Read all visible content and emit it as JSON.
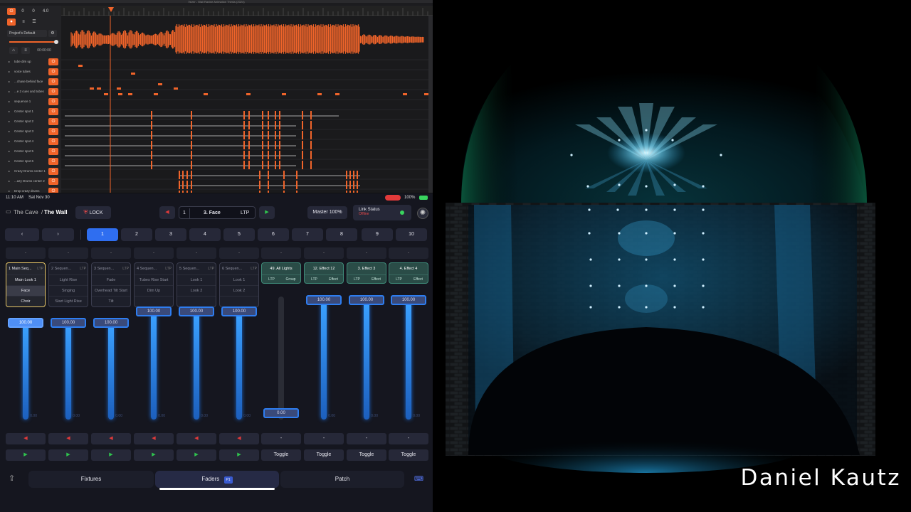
{
  "daw": {
    "title": "Vezer - Wall Ravine Animation Thesis (2024)",
    "time_display": "00:00:00",
    "project_select": "Project's Default",
    "transport_values": [
      "0",
      "0",
      "4.0"
    ],
    "tracks": [
      {
        "name": "tube dim up"
      },
      {
        "name": "voice tubes"
      },
      {
        "name": "...chase behind face"
      },
      {
        "name": "...e 2 cues and tubes"
      },
      {
        "name": "sequence 1"
      },
      {
        "name": "Center spot 1"
      },
      {
        "name": "Center spot 2"
      },
      {
        "name": "Center spot 3"
      },
      {
        "name": "Center spot 4"
      },
      {
        "name": "Center spot 5"
      },
      {
        "name": "Center spot 6"
      },
      {
        "name": "Crazy Drums center 1"
      },
      {
        "name": "...azy Drums center 2"
      },
      {
        "name": "Drop crazy drums"
      }
    ],
    "accent": "#f0642a"
  },
  "status_bar": {
    "time": "11:10 AM",
    "date": "Sat Nov 30",
    "battery": "100%"
  },
  "header": {
    "breadcrumb_parent": "The Cave",
    "breadcrumb_sep": "/",
    "breadcrumb_current": "The Wall",
    "lock_label": "LOCK",
    "cue_number": "1",
    "cue_name": "3. Face",
    "cue_mode": "LTP",
    "master_label": "Master 100%",
    "link_status_label": "Link Status",
    "link_status_value": "Offline"
  },
  "pages": {
    "prev": "‹",
    "next": "›",
    "numbers": [
      "1",
      "2",
      "3",
      "4",
      "5",
      "6",
      "7",
      "8",
      "9",
      "10"
    ],
    "active_index": 0
  },
  "dash_label": "-",
  "playbacks": [
    {
      "num": "1",
      "title": "Main Seq...",
      "mode": "LTP",
      "cues": [
        "Main Look 1",
        "Face",
        "Choir"
      ],
      "style": "selected",
      "level_text": "100.00",
      "level": 1.0
    },
    {
      "num": "2",
      "title": "Sequen...",
      "mode": "LTP",
      "cues": [
        "Light Rise",
        "Singing",
        "Start Light Rise"
      ],
      "style": "normal",
      "level_text": "100.00",
      "level": 1.0
    },
    {
      "num": "3",
      "title": "Sequen...",
      "mode": "LTP",
      "cues": [
        "Fade",
        "Overhead Tilt Start",
        "Tilt"
      ],
      "style": "normal",
      "level_text": "100.00",
      "level": 1.0
    },
    {
      "num": "4",
      "title": "Sequen...",
      "mode": "LTP",
      "cues": [
        "Tubes Rise Start",
        "Dim Up",
        ""
      ],
      "style": "normal",
      "level_text": "100.00",
      "level": 1.0
    },
    {
      "num": "5",
      "title": "Sequen...",
      "mode": "LTP",
      "cues": [
        "Look 1",
        "Look 2",
        ""
      ],
      "style": "normal",
      "level_text": "100.00",
      "level": 1.0
    },
    {
      "num": "6",
      "title": "Sequen...",
      "mode": "LTP",
      "cues": [
        "Look 1",
        "Look 2",
        ""
      ],
      "style": "normal",
      "level_text": "100.00",
      "level": 1.0
    },
    {
      "num": "",
      "title": "49. All Lights",
      "mode": "",
      "tags": [
        "LTP",
        "Group"
      ],
      "style": "group",
      "level_text": "0.00",
      "level": 0.0
    },
    {
      "num": "",
      "title": "12. Effect 12",
      "mode": "",
      "tags": [
        "LTP",
        "Effect"
      ],
      "style": "group",
      "level_text": "100.00",
      "level": 1.0
    },
    {
      "num": "",
      "title": "3. Effect 3",
      "mode": "",
      "tags": [
        "LTP",
        "Effect"
      ],
      "style": "group",
      "level_text": "100.00",
      "level": 1.0
    },
    {
      "num": "",
      "title": "4. Effect 4",
      "mode": "",
      "tags": [
        "LTP",
        "Effect"
      ],
      "style": "group",
      "level_text": "100.00",
      "level": 1.0
    }
  ],
  "fader_zero_label": "0.00",
  "bottom_buttons": {
    "back_glyph": "◀",
    "go_glyph": "▶",
    "dash": "-",
    "toggle": "Toggle"
  },
  "nav": {
    "tabs": [
      "Fixtures",
      "Faders",
      "Patch"
    ],
    "faders_badge": "P1",
    "active": "Faders"
  },
  "signature": "Daniel Kautz",
  "colors": {
    "accent_blue": "#2f6ef0",
    "go_green": "#2fc44e",
    "back_red": "#e03a3a",
    "stage_cyan": "#3ec7ff",
    "stage_green": "#2fe0a0"
  }
}
